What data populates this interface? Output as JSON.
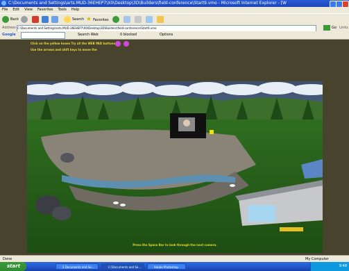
{
  "window": {
    "title": "C:\\Documents and Settings\\arts.MUD-36EHEP7\\X0\\Desktop\\3D\\Builders\\field-conference\\Start9.vmo - Microsoft Internet Explorer - [W"
  },
  "menubar": {
    "items": [
      "File",
      "Edit",
      "View",
      "Favorites",
      "Tools",
      "Help"
    ]
  },
  "toolbar": {
    "back_label": "Back",
    "search_label": "Search",
    "favorites_label": "Favorites"
  },
  "addressbar": {
    "label": "Address",
    "value": "C:\\Documents and Settings\\arts.MUD-36EHEP7\\X0\\Desktop\\3D\\Builders\\field-conference\\Start9.vmo",
    "go_label": "Go",
    "links_label": "Links"
  },
  "googlebar": {
    "brand": "Google",
    "search_web": "Search Web",
    "blocked": "0 blocked",
    "options": "Options"
  },
  "content": {
    "instruction_1": "Click on the yellow boxes Try all the WEB PAD buttons",
    "instruction_2": "Use the arrows and shift keys to move the",
    "bottom_prompt": "Press the Space Bar to look through the next camera."
  },
  "statusbar": {
    "left": "Done",
    "right": "My Computer"
  },
  "taskbar": {
    "start": "start",
    "tasks": [
      "2 Documents and Se...",
      "C:\\Documents and Se...",
      "Adobe Photoshop"
    ],
    "clock": "9:48"
  }
}
